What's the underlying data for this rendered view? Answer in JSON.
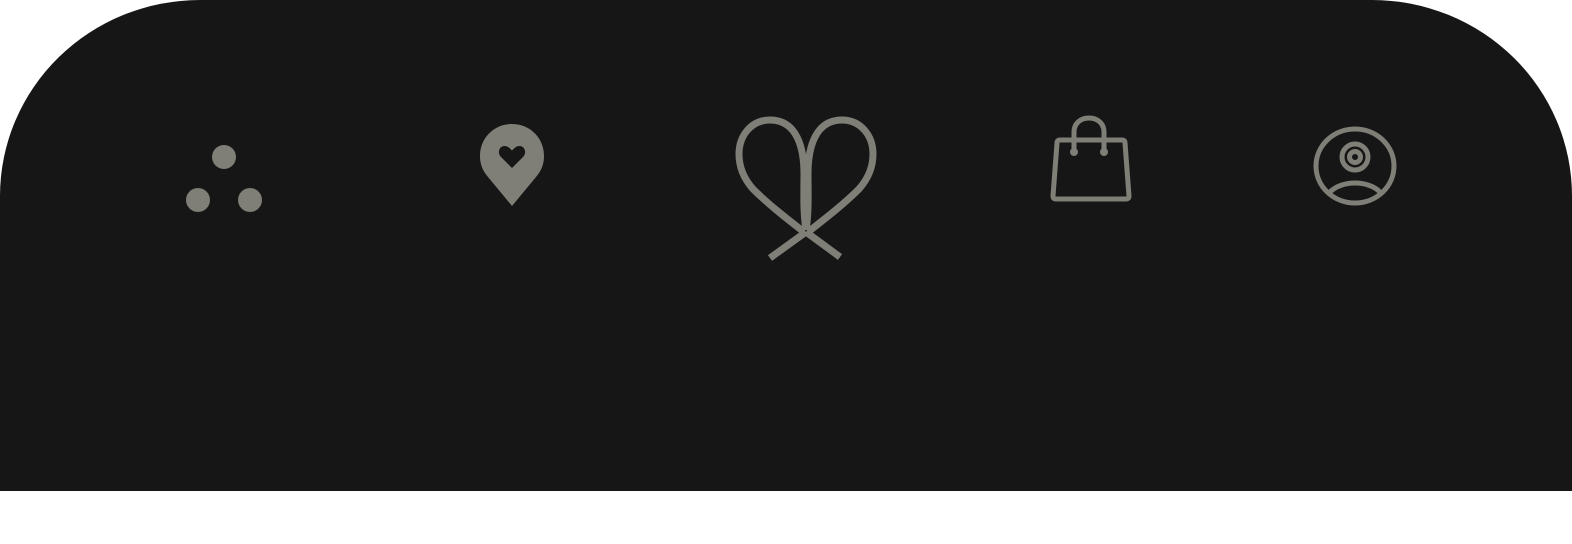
{
  "theme": {
    "bar_background": "#161616",
    "icon_color": "#7f7f78",
    "page_background": "#ffffff"
  },
  "tabbar": {
    "items": [
      {
        "icon": "three-dots-icon"
      },
      {
        "icon": "location-heart-icon"
      },
      {
        "icon": "ribbon-icon"
      },
      {
        "icon": "shopping-bag-icon"
      },
      {
        "icon": "account-circle-icon"
      }
    ]
  }
}
